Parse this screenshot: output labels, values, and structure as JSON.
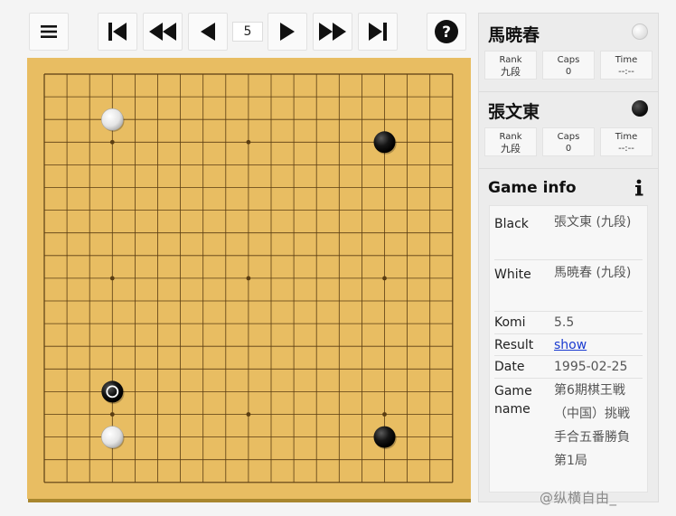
{
  "toolbar": {
    "current_move": "5",
    "buttons": [
      {
        "name": "menu-button",
        "icon": "hamburger-icon"
      },
      {
        "name": "first-move-button",
        "icon": "skip-to-start-icon"
      },
      {
        "name": "fast-backward-button",
        "icon": "fast-backward-icon"
      },
      {
        "name": "previous-move-button",
        "icon": "previous-icon"
      },
      {
        "name": "next-move-button",
        "icon": "next-icon"
      },
      {
        "name": "fast-forward-button",
        "icon": "fast-forward-icon"
      },
      {
        "name": "last-move-button",
        "icon": "skip-to-end-icon"
      },
      {
        "name": "help-button",
        "icon": "help-icon"
      }
    ]
  },
  "board": {
    "size": 19,
    "wood_color": "#e8bd62",
    "line_color": "#5a3d12",
    "star_points": [
      [
        3,
        3
      ],
      [
        9,
        3
      ],
      [
        15,
        3
      ],
      [
        3,
        9
      ],
      [
        9,
        9
      ],
      [
        15,
        9
      ],
      [
        3,
        15
      ],
      [
        9,
        15
      ],
      [
        15,
        15
      ]
    ],
    "stones": [
      {
        "color": "white",
        "col": 3,
        "row": 2
      },
      {
        "color": "black",
        "col": 15,
        "row": 3
      },
      {
        "color": "black",
        "col": 3,
        "row": 14,
        "last_move": true
      },
      {
        "color": "white",
        "col": 3,
        "row": 16
      },
      {
        "color": "black",
        "col": 15,
        "row": 16
      }
    ]
  },
  "players": {
    "white": {
      "name": "馬暁春",
      "rank_label": "Rank",
      "rank": "九段",
      "caps_label": "Caps",
      "caps": "0",
      "time_label": "Time",
      "time": "--:--"
    },
    "black": {
      "name": "張文東",
      "rank_label": "Rank",
      "rank": "九段",
      "caps_label": "Caps",
      "caps": "0",
      "time_label": "Time",
      "time": "--:--"
    }
  },
  "game_info": {
    "title": "Game info",
    "rows": [
      {
        "key": "Black",
        "value": "張文東 (九段)"
      },
      {
        "key": "White",
        "value": "馬暁春 (九段)"
      },
      {
        "key": "Komi",
        "value": "5.5"
      },
      {
        "key": "Result",
        "value": "show"
      },
      {
        "key": "Date",
        "value": "1995-02-25"
      },
      {
        "key": "Game name",
        "value": "第6期棋王戦（中国）挑戦手合五番勝負第1局"
      }
    ]
  },
  "watermark": "@纵横自由_"
}
